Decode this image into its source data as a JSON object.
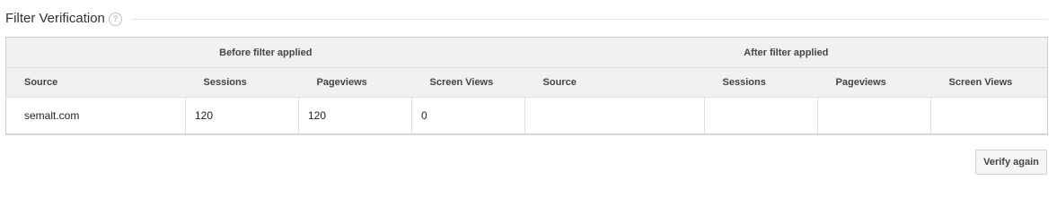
{
  "section": {
    "title": "Filter Verification",
    "help_icon_glyph": "?"
  },
  "table": {
    "groups": {
      "before": "Before filter applied",
      "after": "After filter applied"
    },
    "columns": [
      "Source",
      "Sessions",
      "Pageviews",
      "Screen Views",
      "Source",
      "Sessions",
      "Pageviews",
      "Screen Views"
    ],
    "row": [
      "semalt.com",
      "120",
      "120",
      "0",
      "",
      "",
      "",
      ""
    ]
  },
  "actions": {
    "verify_again_label": "Verify again"
  },
  "icons": {
    "help": "help-circle-icon"
  }
}
